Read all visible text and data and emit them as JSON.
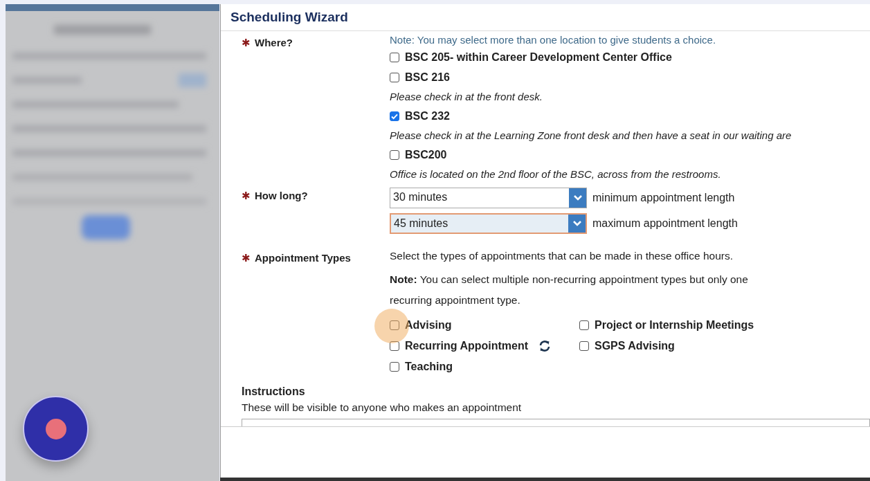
{
  "dialog": {
    "title": "Scheduling Wizard"
  },
  "where": {
    "mark": "✱",
    "label": "Where?",
    "note": "Note: You may select more than one location to give students a choice.",
    "options": [
      {
        "label": "BSC 205- within Career Development Center Office",
        "checked": false
      },
      {
        "label": "BSC 216",
        "checked": false,
        "hint": "Please check in at the front desk."
      },
      {
        "label": "BSC 232",
        "checked": true,
        "hint": "Please check in at the Learning Zone front desk and then have a seat in our waiting are"
      },
      {
        "label": "BSC200",
        "checked": false,
        "hint": "Office is located on the 2nd floor of the BSC, across from the restrooms."
      }
    ]
  },
  "how_long": {
    "mark": "✱",
    "label": "How long?",
    "selects": [
      {
        "value": "30 minutes",
        "caption": "minimum appointment length",
        "focused": false
      },
      {
        "value": "45 minutes",
        "caption": "maximum appointment length",
        "focused": true
      }
    ]
  },
  "appointment_types": {
    "mark": "✱",
    "label": "Appointment Types",
    "intro": "Select the types of appointments that can be made in these office hours.",
    "note": "**Note:** You can select multiple non-recurring appointment types but only one recurring appointment type.",
    "options": [
      {
        "label": "Advising",
        "checked": false,
        "kind": "standard"
      },
      {
        "label": "Project or Internship Meetings",
        "checked": false,
        "kind": "standard"
      },
      {
        "label": "Recurring Appointment",
        "checked": false,
        "kind": "recurring"
      },
      {
        "label": "SGPS Advising",
        "checked": false,
        "kind": "standard"
      },
      {
        "label": "Teaching",
        "checked": false,
        "kind": "standard"
      }
    ]
  },
  "instructions": {
    "label": "Instructions",
    "hint": "These will be visible to anyone who makes an appointment"
  }
}
